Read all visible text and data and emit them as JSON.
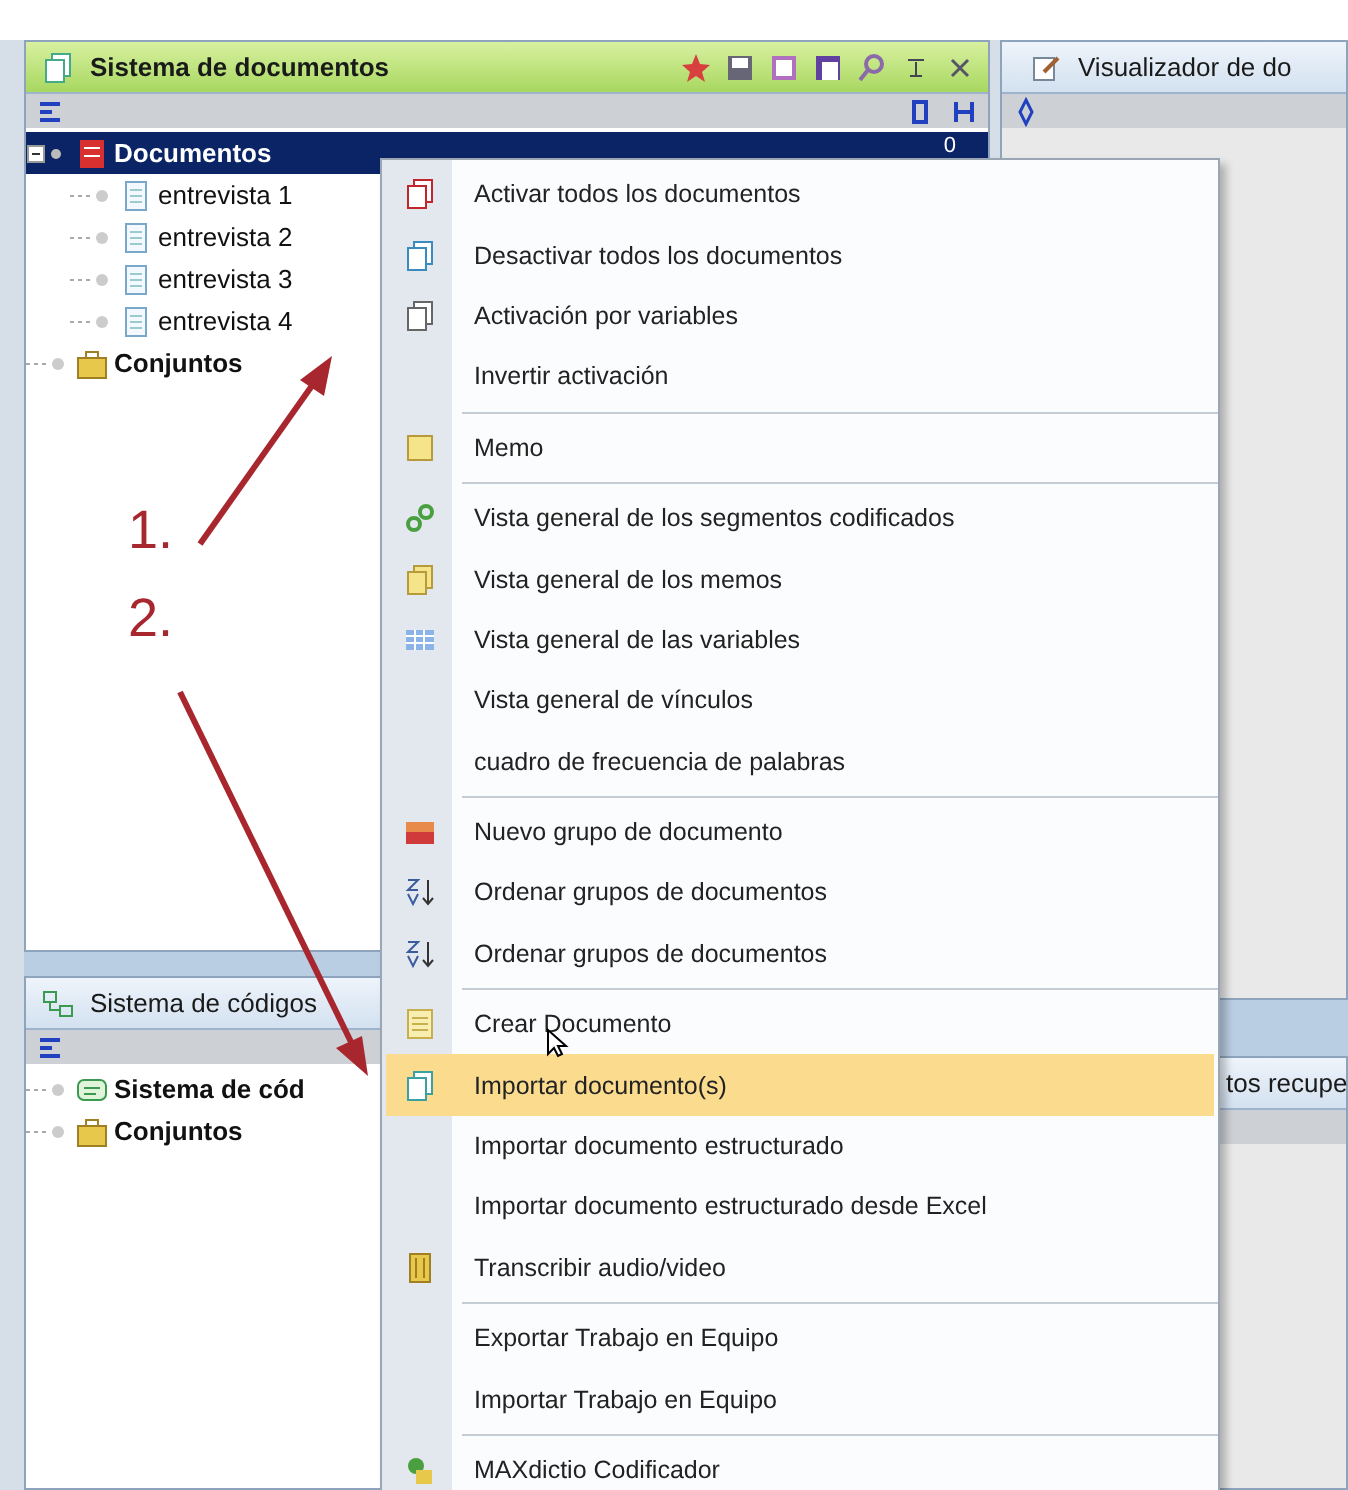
{
  "documents_pane": {
    "title": "Sistema de documentos",
    "tree": [
      {
        "label": "Documentos",
        "count": "0",
        "selected": true,
        "children": [
          {
            "label": "entrevista 1",
            "selected": false
          },
          {
            "label": "entrevista 2",
            "selected": false
          },
          {
            "label": "entrevista 3",
            "selected": false
          },
          {
            "label": "entrevista 4",
            "selected": false
          }
        ]
      },
      {
        "label": "Conjuntos",
        "selected": false
      }
    ]
  },
  "viewer_pane": {
    "title": "Visualizador de do"
  },
  "codes_pane": {
    "title": "Sistema de códigos",
    "tree": [
      {
        "label": "Sistema de cód",
        "selected": false
      },
      {
        "label": "Conjuntos",
        "selected": false
      }
    ]
  },
  "retrieved_pane": {
    "title": "tos recupe"
  },
  "context_menu": {
    "sections": [
      [
        {
          "label": "Activar todos los documentos",
          "selected": false
        },
        {
          "label": "Desactivar todos los documentos",
          "selected": false
        },
        {
          "label": "Activación por variables",
          "selected": false
        },
        {
          "label": "Invertir activación",
          "selected": false
        }
      ],
      [
        {
          "label": "Memo",
          "selected": false
        }
      ],
      [
        {
          "label": "Vista general de los segmentos codificados",
          "selected": false
        },
        {
          "label": "Vista general de los memos",
          "selected": false
        },
        {
          "label": "Vista general de las variables",
          "selected": false
        },
        {
          "label": "Vista general de vínculos",
          "selected": false
        },
        {
          "label": "cuadro  de frecuencia de palabras",
          "selected": false
        }
      ],
      [
        {
          "label": "Nuevo grupo de documento",
          "selected": false
        },
        {
          "label": "Ordenar grupos de documentos",
          "selected": false
        },
        {
          "label": "Ordenar grupos de documentos",
          "selected": false
        }
      ],
      [
        {
          "label": "Crear Documento",
          "selected": false
        },
        {
          "label": "Importar documento(s)",
          "selected": true
        },
        {
          "label": "Importar documento estructurado",
          "selected": false
        },
        {
          "label": "Importar documento estructurado desde Excel",
          "selected": false
        },
        {
          "label": "Transcribir audio/video",
          "selected": false
        }
      ],
      [
        {
          "label": "Exportar Trabajo en Equipo",
          "selected": false
        },
        {
          "label": "Importar Trabajo en Equipo",
          "selected": false
        }
      ],
      [
        {
          "label": "MAXdictio Codificador",
          "selected": false
        }
      ]
    ]
  },
  "annotations": [
    "1.",
    "2."
  ]
}
